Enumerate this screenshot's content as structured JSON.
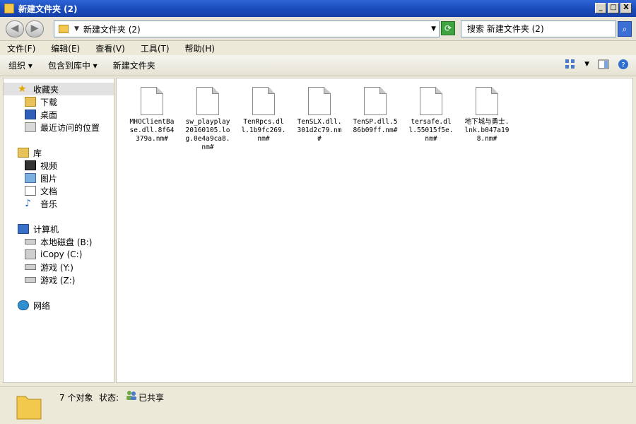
{
  "window": {
    "title": "新建文件夹 (2)",
    "controls": {
      "minimize": "_",
      "maximize": "□",
      "close": "X"
    }
  },
  "address": {
    "path": "新建文件夹 (2)"
  },
  "search": {
    "placeholder": "搜索 新建文件夹 (2)"
  },
  "menu": [
    "文件(F)",
    "编辑(E)",
    "查看(V)",
    "工具(T)",
    "帮助(H)"
  ],
  "toolbar": {
    "organize": "组织 ▾",
    "include_library": "包含到库中 ▾",
    "new_folder": "新建文件夹"
  },
  "nav": {
    "favorites": {
      "label": "收藏夹",
      "items": [
        "下载",
        "桌面",
        "最近访问的位置"
      ]
    },
    "libraries": {
      "label": "库",
      "items": [
        "视频",
        "图片",
        "文档",
        "音乐"
      ]
    },
    "computer": {
      "label": "计算机",
      "items": [
        "本地磁盘 (B:)",
        "iCopy (C:)",
        "游戏 (Y:)",
        "游戏 (Z:)"
      ]
    },
    "network": {
      "label": "网络"
    }
  },
  "files": [
    {
      "name": "MHOClientBase.dll.8f64379a.nm#"
    },
    {
      "name": "sw_playplay20160105.log.0e4a9ca8.nm#"
    },
    {
      "name": "TenRpcs.dll.1b9fc269.nm#"
    },
    {
      "name": "TenSLX.dll.301d2c79.nm#"
    },
    {
      "name": "TenSP.dll.586b09ff.nm#"
    },
    {
      "name": "tersafe.dll.55015f5e.nm#"
    },
    {
      "name": "地下城与勇士.lnk.b047a198.nm#"
    }
  ],
  "status": {
    "count": "7 个对象",
    "state_label": "状态:",
    "state_value": "已共享"
  }
}
